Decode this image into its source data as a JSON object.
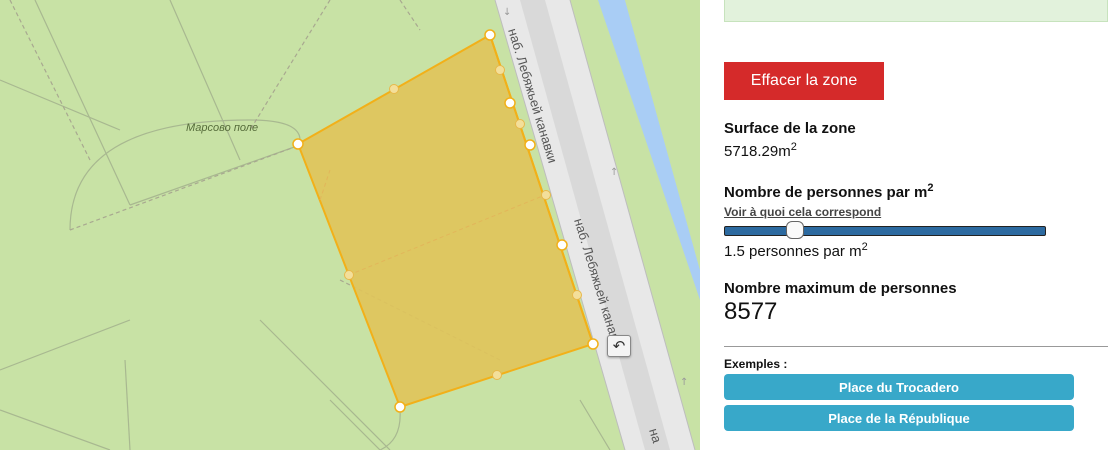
{
  "map": {
    "park_label": "Марсово поле",
    "street_label": "наб. Лебяжьей канавки",
    "street_label_cut": "на",
    "undo_icon": "undo-icon",
    "colors": {
      "park": "#c8e2a5",
      "road": "#e8e8e8",
      "canal": "#a9cdf5",
      "zone_fill": "#e0c45a",
      "zone_stroke": "#f2b019"
    }
  },
  "panel": {
    "clear_button": "Effacer la zone",
    "surface_title": "Surface de la zone",
    "surface_value": "5718.29m",
    "surface_unit_sup": "2",
    "density_title": "Nombre de personnes par m",
    "density_title_sup": "2",
    "density_link": "Voir à quoi cela correspond",
    "density_value_text": "1.5 personnes par m",
    "density_value_sup": "2",
    "density_slider_fraction": 0.22,
    "max_title": "Nombre maximum de personnes",
    "max_value": "8577",
    "examples_label": "Exemples :",
    "examples": [
      "Place du Trocadero",
      "Place de la République"
    ],
    "colors": {
      "clear_button": "#d52a2a",
      "example_button": "#38a8c9",
      "slider": "#2c6aa0"
    }
  }
}
